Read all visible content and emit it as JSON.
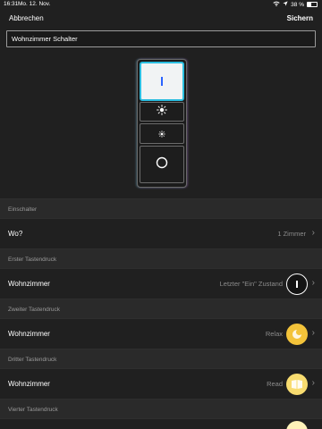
{
  "status_bar": {
    "time": "16:31",
    "date": "Mo. 12. Nov.",
    "battery_text": "38 %",
    "battery_level": 0.38
  },
  "nav": {
    "cancel_label": "Abbrechen",
    "save_label": "Sichern"
  },
  "name_field": {
    "value": "Wohnzimmer Schalter"
  },
  "sections": {
    "on_switch": "Einschalter",
    "first_press": "Erster Tastendruck",
    "second_press": "Zweiter Tastendruck",
    "third_press": "Dritter Tastendruck",
    "fourth_press": "Vierter Tastendruck"
  },
  "rows": {
    "where": {
      "label": "Wo?",
      "value": "1 Zimmer"
    },
    "first": {
      "label": "Wohnzimmer",
      "value": "Letzter \"Ein\" Zustand"
    },
    "second": {
      "label": "Wohnzimmer",
      "value": "Relax"
    },
    "third": {
      "label": "Wohnzimmer",
      "value": "Read"
    }
  },
  "colors": {
    "background": "#202020",
    "section_bg": "#2a2a2a",
    "relax": "#f3c33a",
    "read": "#f8dc70",
    "concentrate": "#fff2b8",
    "switch_highlight": "#2bbde0"
  },
  "icons": {
    "wifi": "wifi-icon",
    "location": "location-icon",
    "battery": "battery-icon",
    "brightness_up": "sun-large-icon",
    "brightness_down": "sun-small-icon",
    "power_off": "circle-icon",
    "chevron": "chevron-right-icon"
  }
}
